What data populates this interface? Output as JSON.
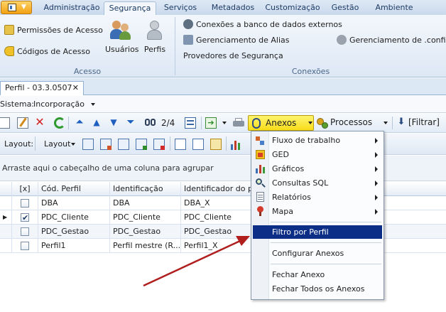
{
  "ribbon_tabs": [
    "Administração",
    "Segurança",
    "Serviços",
    "Metadados",
    "Customização",
    "Gestão",
    "Ambiente"
  ],
  "ribbon": {
    "acesso": {
      "permissoes": "Permissões de Acesso",
      "codigos": "Códigos de Acesso",
      "usuarios": "Usuários",
      "perfis": "Perfis",
      "label": "Acesso"
    },
    "conexoes": {
      "externos": "Conexões a banco de dados externos",
      "alias": "Gerenciamento de Alias",
      "provedores": "Provedores de Segurança",
      "config": "Gerenciamento de .config",
      "label": "Conexões"
    }
  },
  "doc_tab": {
    "title": "Perfil - 03.3.0507",
    "close": "✕"
  },
  "sistema": {
    "label": "Sistema:",
    "value": "Incorporação"
  },
  "toolbar": {
    "page": "2/4",
    "anexos": "Anexos",
    "processos": "Processos",
    "filtrar": "[Filtrar]",
    "layout_label": "Layout:",
    "layout_dropdown": "Layout"
  },
  "groupby_hint": "Arraste aqui o cabeçalho de uma coluna para agrupar",
  "grid": {
    "headers": [
      "[x]",
      "Cód. Perfil",
      "Identificação",
      "Identificador do p..."
    ],
    "rows": [
      {
        "checked": false,
        "cod": "DBA",
        "ident": "DBA",
        "idp": "DBA_X"
      },
      {
        "checked": true,
        "cod": "PDC_Cliente",
        "ident": "PDC_Cliente",
        "idp": "PDC_Cliente"
      },
      {
        "checked": false,
        "cod": "PDC_Gestao",
        "ident": "PDC_Gestao",
        "idp": "PDC_Gestao"
      },
      {
        "checked": false,
        "cod": "Perfil1",
        "ident": "Perfil mestre (R...",
        "idp": "Perfil1_X"
      }
    ]
  },
  "menu": {
    "items": [
      "Fluxo de trabalho",
      "GED",
      "Gráficos",
      "Consultas SQL",
      "Relatórios",
      "Mapa",
      "Filtro por Perfil",
      "Configurar Anexos",
      "Fechar Anexo",
      "Fechar Todos os Anexos"
    ],
    "highlight_color": "#0c2e86"
  },
  "annotation_arrow_color": "#b01e1e"
}
